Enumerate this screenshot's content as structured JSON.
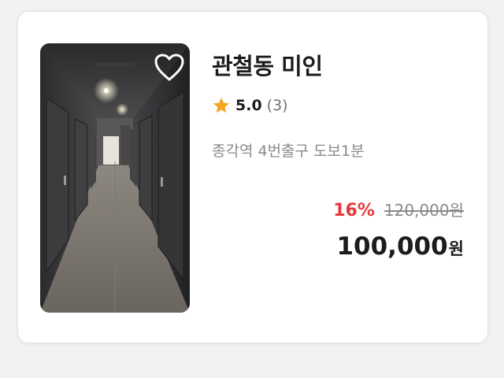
{
  "listing": {
    "title": "관철동 미인",
    "rating": {
      "score": "5.0",
      "count": "(3)"
    },
    "location": "종각역 4번출구 도보1분",
    "price": {
      "discount": "16%",
      "original": "120,000원",
      "final_amount": "100,000",
      "final_unit": "원"
    },
    "favorite": {
      "icon": "heart-outline-icon",
      "active": false
    }
  },
  "colors": {
    "discount": "#e8383d",
    "star": "#f5a623",
    "title": "#1c1c1e",
    "muted": "#8a8a8e"
  }
}
